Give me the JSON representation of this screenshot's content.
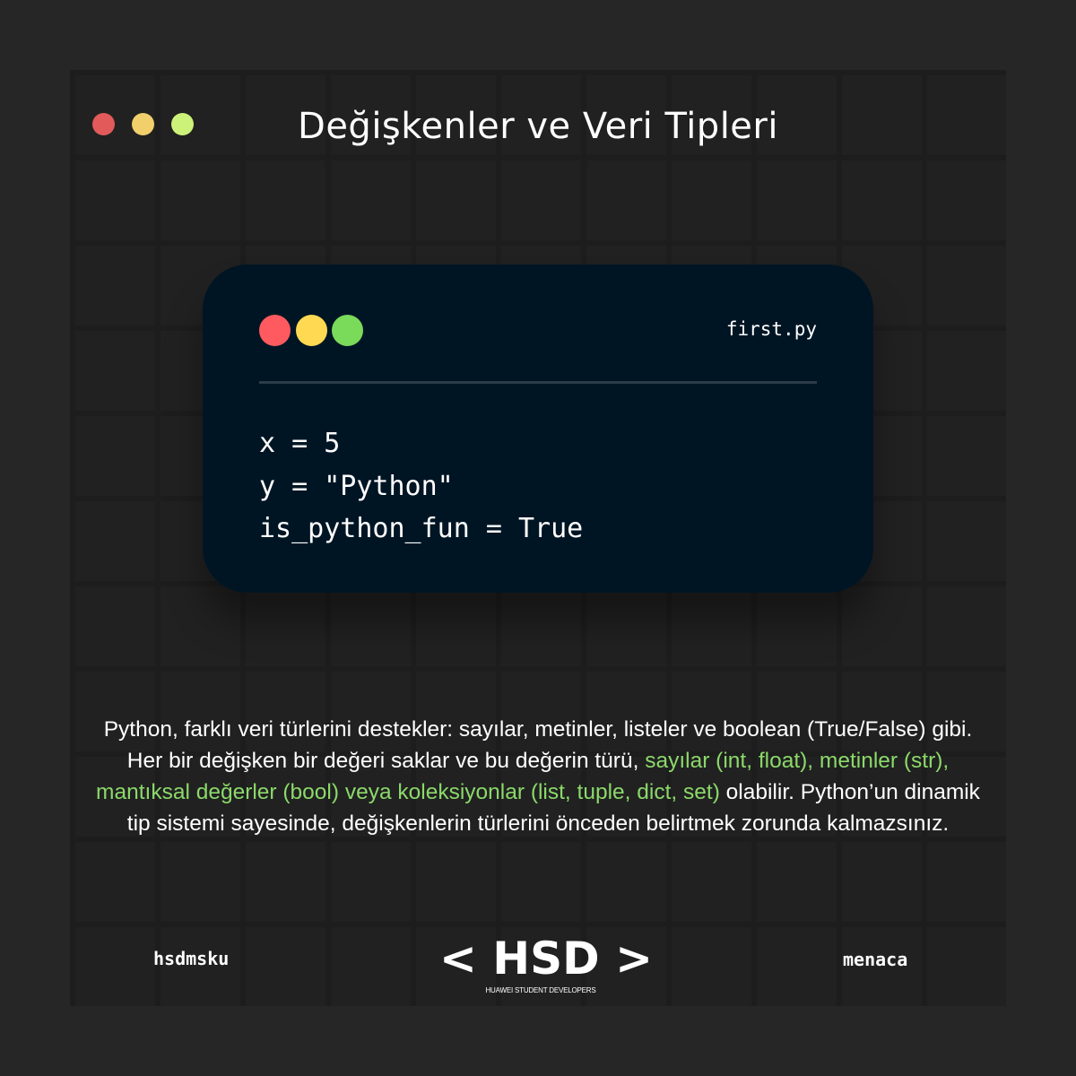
{
  "window_controls": {
    "colors": [
      "#e25a5a",
      "#f1cf6b",
      "#cdf27a"
    ]
  },
  "title": "Değişkenler ve Veri Tipleri",
  "code_card": {
    "colors": [
      "#ff5a5f",
      "#ffd952",
      "#7ada5a"
    ],
    "filename": "first.py",
    "lines": [
      "x = 5",
      "y = \"Python\"",
      "is_python_fun = True"
    ]
  },
  "description": {
    "text_before": "Python, farklı veri türlerini destekler: sayılar, metinler, listeler ve boolean (True/False) gibi. Her bir değişken bir değeri saklar ve bu değerin türü, ",
    "highlight": "sayılar (int, float), metinler (str), mantıksal değerler (bool) veya koleksiyonlar (list, tuple, dict, set)",
    "text_after": " olabilir. Python’un dinamik tip sistemi sayesinde, değişkenlerin türlerini önceden belirtmek zorunda kalmazsınız.",
    "highlight_color": "#8bd96a"
  },
  "footer": {
    "left": "hsdmsku",
    "right": "menaca",
    "logo": {
      "main": "< HSD >",
      "sub": "HUAWEI STUDENT DEVELOPERS"
    }
  }
}
